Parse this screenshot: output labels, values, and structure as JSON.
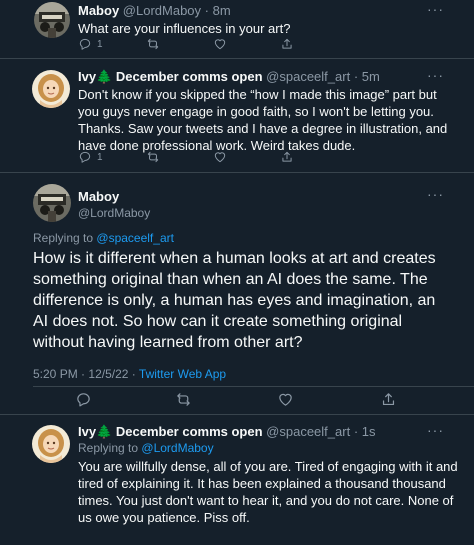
{
  "tweets": [
    {
      "name": "Maboy",
      "handle": "@LordMaboy",
      "sep": "·",
      "time": "8m",
      "text": "What are your influences in your art?",
      "reply_count": "1"
    },
    {
      "name": "Ivy🌲 December comms open",
      "handle": "@spaceelf_art",
      "sep": "·",
      "time": "5m",
      "text": "Don't know if you skipped the “how I made this image” part but you guys never engage in good faith, so I won't be letting you. Thanks. Saw your tweets and I have a degree in illustration, and have done professional work. Weird takes dude.",
      "reply_count": "1"
    }
  ],
  "main_tweet": {
    "name": "Maboy",
    "handle": "@LordMaboy",
    "replying_prefix": "Replying to",
    "replying_to": "@spaceelf_art",
    "text": "How is it different when a human looks at art and creates something original than when an AI does the same. The difference is only, a human has eyes and imagination, an AI does not. So how can it create something original without having learned from other art?",
    "time": "5:20 PM",
    "dot": "·",
    "date": "12/5/22",
    "source": "Twitter Web App"
  },
  "reply": {
    "name": "Ivy🌲 December comms open",
    "handle": "@spaceelf_art",
    "sep": "·",
    "time": "1s",
    "replying_prefix": "Replying to",
    "replying_to": "@LordMaboy",
    "text": "You are willfully dense, all of you are. Tired of engaging with it and tired of explaining it. It has been explained a thousand thousand times. You just don't want to hear it, and you do not care. None of us owe you patience. Piss off."
  },
  "menu_glyph": "···",
  "colors": {
    "background": "#15202b",
    "text": "#f7f9f9",
    "muted": "#8b98a5",
    "link": "#1d9bf0",
    "divider": "#38444d"
  }
}
